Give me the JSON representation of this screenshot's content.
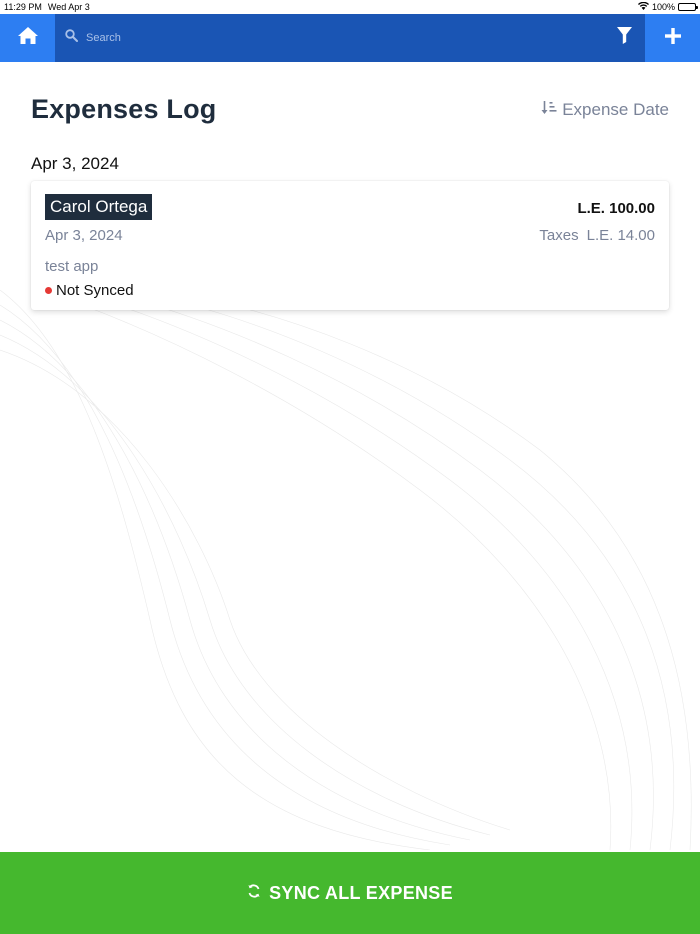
{
  "status_bar": {
    "time": "11:29 PM",
    "date": "Wed Apr 3",
    "battery": "100%"
  },
  "top_bar": {
    "search_placeholder": "Search",
    "home_icon": "home-icon",
    "filter_icon": "filter-icon",
    "add_icon": "plus-icon"
  },
  "header": {
    "title": "Expenses Log",
    "sort_label": "Expense Date",
    "sort_icon": "sort-icon"
  },
  "groups": [
    {
      "date": "Apr 3, 2024",
      "items": [
        {
          "employee": "Carol Ortega",
          "amount": "L.E. 100.00",
          "date": "Apr 3, 2024",
          "taxes_label": "Taxes",
          "taxes_value": "L.E. 14.00",
          "description": "test app",
          "sync_status": "Not Synced",
          "sync_status_color": "#e53935"
        }
      ]
    }
  ],
  "footer": {
    "sync_button_label": "SYNC ALL EXPENSE",
    "sync_icon": "sync-icon"
  },
  "colors": {
    "top_bar": "#1a55b4",
    "accent_button": "#2d7ef2",
    "sync_button": "#45b82e",
    "title_text": "#1f2d3d"
  }
}
